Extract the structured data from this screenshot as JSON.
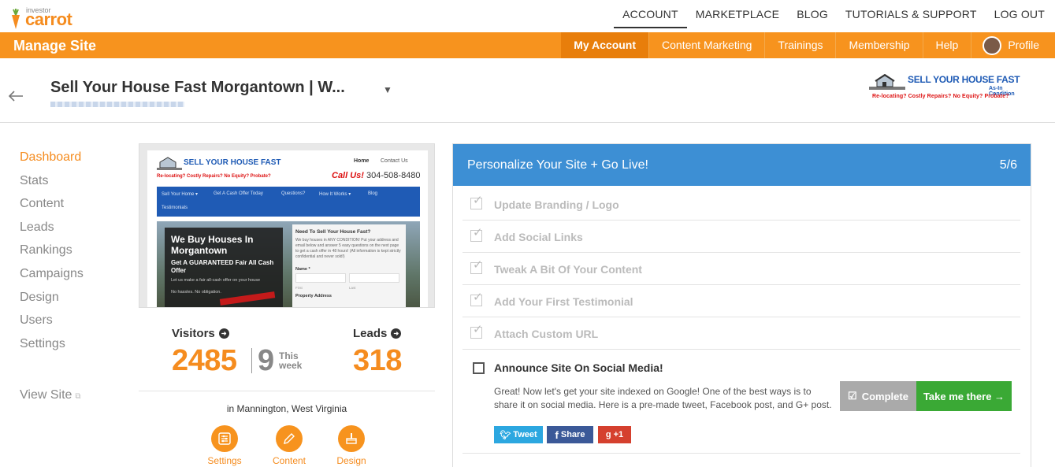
{
  "logo": {
    "small": "investor",
    "big": "carrot"
  },
  "top_nav": [
    "ACCOUNT",
    "MARKETPLACE",
    "BLOG",
    "TUTORIALS & SUPPORT",
    "LOG OUT"
  ],
  "manage_title": "Manage Site",
  "sub_nav": {
    "my_account": "My Account",
    "content_marketing": "Content Marketing",
    "trainings": "Trainings",
    "membership": "Membership",
    "help": "Help",
    "profile": "Profile"
  },
  "site": {
    "title": "Sell Your House Fast Morgantown | W...",
    "caret": "▼"
  },
  "brand_logo": {
    "line1": "SELL YOUR HOUSE FAST",
    "line1b": "As-In Condition",
    "line2": "Re-locating?  Costly Repairs?  No Equity?  Probate?"
  },
  "sidebar": {
    "items": [
      "Dashboard",
      "Stats",
      "Content",
      "Leads",
      "Rankings",
      "Campaigns",
      "Design",
      "Users",
      "Settings"
    ],
    "view_site": "View Site"
  },
  "preview": {
    "logo1": "SELL YOUR HOUSE FAST",
    "logo2": "Re-locating?  Costly Repairs?  No Equity?  Probate?",
    "home": "Home",
    "contact": "Contact Us",
    "call": "Call Us!",
    "phone": "304-508-8480",
    "nav": [
      "Sell Your Home ▾",
      "Get A Cash Offer Today",
      "Questions?",
      "How It Works ▾",
      "Blog",
      "Testimonials"
    ],
    "hero_heading": "We Buy Houses In Morgantown",
    "hero_sub": "Get A GUARANTEED Fair All Cash Offer",
    "hero_text": "Let us make a fair all-cash offer on your house",
    "hero_text2": "No hassles. No obligation.",
    "form_heading": "Need To Sell Your House Fast?",
    "form_text": "We buy houses in ANY CONDITION! Put your address and email below and answer 5 easy questions on the next page to get a cash offer in 48 hours! (All information is kept strictly confidential and never sold!)",
    "form_name": "Name *",
    "form_first": "First",
    "form_last": "Last",
    "form_address": "Property Address"
  },
  "stats": {
    "visitors_label": "Visitors",
    "visitors": "2485",
    "week_visitors": "9",
    "this_week": "This week",
    "leads_label": "Leads",
    "leads": "318"
  },
  "location": "in Mannington, West Virginia",
  "quick_links": [
    "Settings",
    "Content",
    "Design"
  ],
  "panel": {
    "title": "Personalize Your Site + Go Live!",
    "count": "5/6",
    "done_tasks": [
      "Update Branding / Logo",
      "Add Social Links",
      "Tweak A Bit Of Your Content",
      "Add Your First Testimonial",
      "Attach Custom URL"
    ],
    "open_task": {
      "title": "Announce Site On Social Media!",
      "desc": "Great! Now let's get your site indexed on Google! One of the best ways is to share it on social media. Here is a pre-made tweet, Facebook post, and G+ post.",
      "complete": "Complete",
      "take": "Take me there →",
      "tweet": "Tweet",
      "share": "Share",
      "gplus_label": "+1"
    }
  },
  "colors": {
    "orange": "#f7931e",
    "blue": "#3d8fd4",
    "green": "#3aa935"
  }
}
